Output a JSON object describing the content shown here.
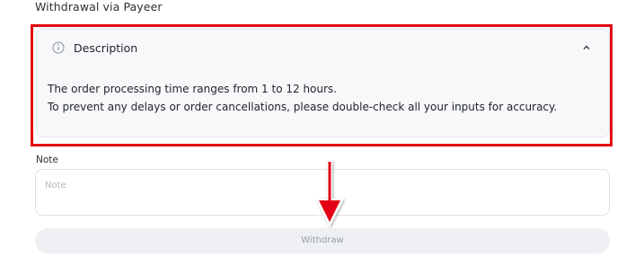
{
  "page": {
    "title": "Withdrawal via Payeer"
  },
  "description": {
    "icon": "info-icon",
    "title": "Description",
    "toggle_icon": "chevron-up-icon",
    "lines": [
      "The order processing time ranges from 1 to 12 hours.",
      "To prevent any delays or order cancellations, please double-check all your inputs for accuracy."
    ]
  },
  "note": {
    "label": "Note",
    "placeholder": "Note",
    "value": ""
  },
  "withdraw": {
    "label": "Withdraw",
    "state": "disabled"
  },
  "annotations": {
    "highlight_color": "#e30613",
    "arrow_icon": "arrow-down-icon"
  }
}
